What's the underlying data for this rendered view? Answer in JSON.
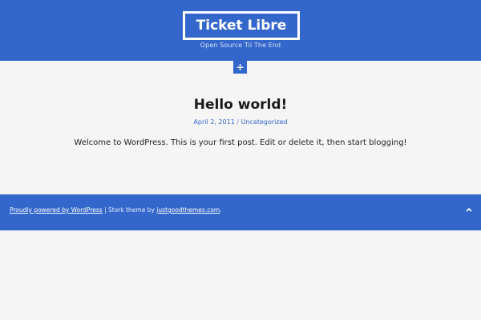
{
  "header": {
    "site_title": "Ticket Libre",
    "tagline": "Open Source Til The End",
    "menu_toggle_icon": "plus-icon",
    "menu_toggle_glyph": "+"
  },
  "post": {
    "title": "Hello world!",
    "date": "April 2, 2011",
    "separator": "/",
    "category": "Uncategorized",
    "content": "Welcome to WordPress. This is your first post. Edit or delete it, then start blogging!"
  },
  "footer": {
    "powered_link": "Proudly powered by WordPress",
    "divider": " | ",
    "theme_text": "Stork theme by ",
    "theme_author_link": "justgoodthemes.com",
    "trailing": ".",
    "back_to_top_icon": "chevron-up-icon"
  },
  "colors": {
    "accent": "#3467cc",
    "background": "#f5f5f5",
    "text": "#222222"
  }
}
